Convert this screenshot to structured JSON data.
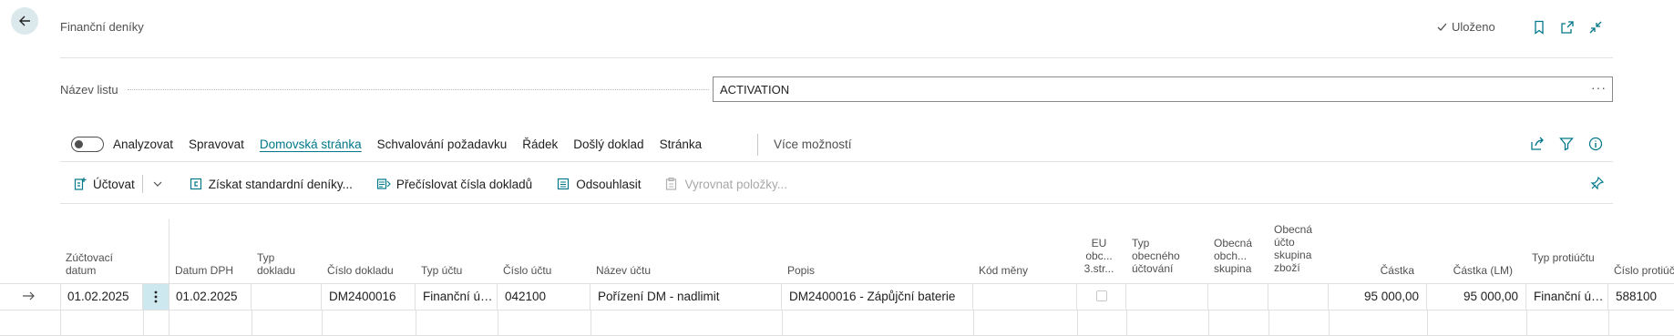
{
  "header": {
    "title": "Finanční deníky",
    "saved_label": "Uloženo"
  },
  "batch": {
    "label": "Název listu",
    "value": "ACTIVATION",
    "more": "···"
  },
  "tabs": {
    "analyze": "Analyzovat",
    "items": [
      "Spravovat",
      "Domovská stránka",
      "Schvalování požadavku",
      "Řádek",
      "Došlý doklad",
      "Stránka"
    ],
    "active_index": 1,
    "more": "Více možností"
  },
  "actions": {
    "post": "Účtovat",
    "get_standard": "Získat standardní deníky...",
    "renumber": "Přečíslovat čísla dokladů",
    "reconcile": "Odsouhlasit",
    "apply_entries": "Vyrovnat položky..."
  },
  "columns": {
    "posting_date": "Zúčtovací datum",
    "vat_date": "Datum DPH",
    "doc_type": "Typ dokladu",
    "doc_no": "Číslo dokladu",
    "account_type": "Typ účtu",
    "account_no": "Číslo účtu",
    "account_name": "Název účtu",
    "description": "Popis",
    "currency": "Kód měny",
    "eu_third": "EU obc... 3.str...",
    "gen_posting_type": "Typ obecného účtování",
    "gen_bus_group": "Obecná obch... skupina",
    "gen_prod_group": "Obecná účto skupina zboží",
    "amount": "Částka",
    "amount_lcy": "Částka (LM)",
    "bal_account_type": "Typ protiúčtu",
    "bal_account_no": "Číslo protiúčt"
  },
  "rows": [
    {
      "posting_date": "01.02.2025",
      "vat_date": "01.02.2025",
      "doc_type": "",
      "doc_no": "DM2400016",
      "account_type": "Finanční úč...",
      "account_no": "042100",
      "account_name": "Pořízení DM - nadlimit",
      "description": "DM2400016 - Zápůjční baterie",
      "currency": "",
      "eu_third": false,
      "gen_posting_type": "",
      "gen_bus_group": "",
      "gen_prod_group": "",
      "amount": "95 000,00",
      "amount_lcy": "95 000,00",
      "bal_account_type": "Finanční úč...",
      "bal_account_no": "588100"
    }
  ],
  "colors": {
    "accent": "#00788a",
    "selected_cell": "#cde8ef"
  }
}
